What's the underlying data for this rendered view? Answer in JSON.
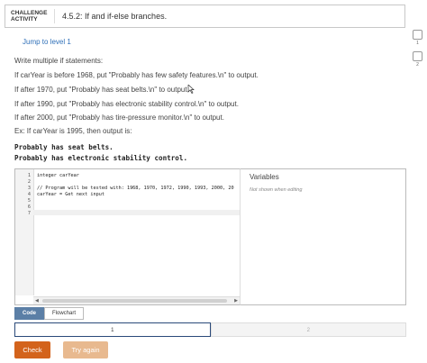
{
  "header": {
    "badge_line1": "CHALLENGE",
    "badge_line2": "ACTIVITY",
    "title": "4.5.2: If and if-else branches."
  },
  "progress": [
    {
      "number": "1"
    },
    {
      "number": "2"
    }
  ],
  "jump_link": "Jump to level 1",
  "instructions": [
    "Write multiple if statements:",
    "If carYear is before 1968, put \"Probably has few safety features.\\n\" to output.",
    "If after 1970, put \"Probably has seat belts.\\n\" to output.",
    "If after 1990, put \"Probably has electronic stability control.\\n\" to output.",
    "If after 2000, put \"Probably has tire-pressure monitor.\\n\" to output.",
    "Ex: If carYear is 1995, then output is:"
  ],
  "example_output": [
    "Probably has seat belts.",
    "Probably has electronic stability control."
  ],
  "editor": {
    "line_numbers": [
      "1",
      "2",
      "3",
      "4",
      "5",
      "6",
      "7"
    ],
    "lines": [
      "integer carYear",
      "",
      "// Program will be tested with: 1968, 1970, 1972, 1990, 1993, 2000, 20",
      "carYear = Get next input",
      "",
      "",
      ""
    ]
  },
  "variables": {
    "title": "Variables",
    "note": "Not shown when editing"
  },
  "tabs": [
    {
      "label": "Code"
    },
    {
      "label": "Flowchart"
    }
  ],
  "levels": [
    {
      "label": "1"
    },
    {
      "label": "2"
    }
  ],
  "buttons": {
    "check": "Check",
    "try_again": "Try again"
  },
  "colors": {
    "accent_orange": "#d3631c",
    "link_blue": "#2e6fb8",
    "tab_active": "#5b7fa6"
  }
}
